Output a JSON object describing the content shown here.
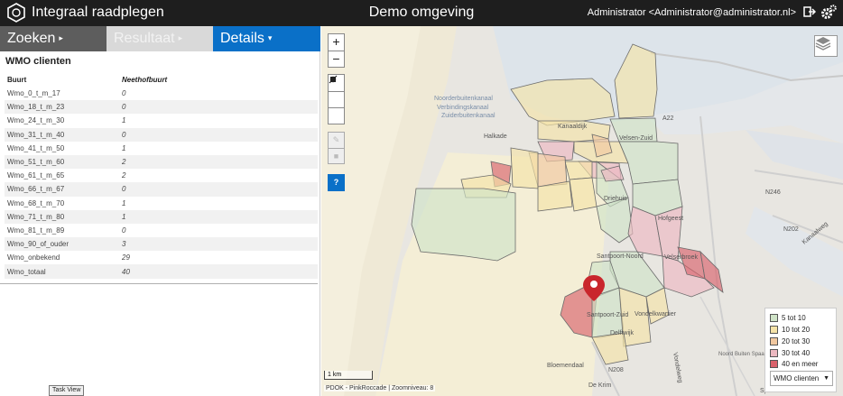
{
  "header": {
    "app_title": "Integraal raadplegen",
    "env_title": "Demo omgeving",
    "user": "Administrator <Administrator@administrator.nl>",
    "icons": [
      "app-logo-icon",
      "logout-icon",
      "settings-cogs-icon"
    ]
  },
  "tabs": [
    {
      "label": "Zoeken",
      "arrow": "▸"
    },
    {
      "label": "Resultaat",
      "arrow": "▸"
    },
    {
      "label": "Details",
      "arrow": "▾"
    }
  ],
  "panel": {
    "title": "WMO clienten",
    "columns": [
      "Buurt",
      "Neethofbuurt"
    ],
    "rows": [
      [
        "Wmo_0_t_m_17",
        "0"
      ],
      [
        "Wmo_18_t_m_23",
        "0"
      ],
      [
        "Wmo_24_t_m_30",
        "1"
      ],
      [
        "Wmo_31_t_m_40",
        "0"
      ],
      [
        "Wmo_41_t_m_50",
        "1"
      ],
      [
        "Wmo_51_t_m_60",
        "2"
      ],
      [
        "Wmo_61_t_m_65",
        "2"
      ],
      [
        "Wmo_66_t_m_67",
        "0"
      ],
      [
        "Wmo_68_t_m_70",
        "1"
      ],
      [
        "Wmo_71_t_m_80",
        "1"
      ],
      [
        "Wmo_81_t_m_89",
        "0"
      ],
      [
        "Wmo_90_of_ouder",
        "3"
      ],
      [
        "Wmo_onbekend",
        "29"
      ],
      [
        "Wmo_totaal",
        "40"
      ]
    ]
  },
  "map": {
    "zoom_in": "+",
    "zoom_out": "−",
    "help": "?",
    "scale": "1 km",
    "attribution": "PDOK - PinkRoccade | Zoomniveau: 8",
    "labels": {
      "noordzeekanaal": "Noorderbuitenkanaal",
      "verbinding": "Verbindingskanaal",
      "zuiderbuiten": "Zuiderbuitenkanaal",
      "kanaaldijk": "Kanaaldijk",
      "velsen_zuid": "Velsen-Zuid",
      "driehuis": "Driehuis",
      "hofgeest": "Hofgeest",
      "santpoort_noord": "Santpoort-Noord",
      "velserbroek": "Velserbroek",
      "santpoort_zuid": "Santpoort-Zuid",
      "vondelkwartier": "Vondelkwartier",
      "delftwijk": "Delftwijk",
      "bloemendaal": "Bloemendaal",
      "de_krim": "De Krim",
      "spaarnwoude": "Spaarnwoude",
      "n246": "N246",
      "n202": "N202",
      "n208": "N208",
      "a22": "A22",
      "kanaalweg": "Kanaalweg",
      "vondelweg": "Vondelweg",
      "buitenrust": "Noord Buiten Spaarne",
      "halkade": "Halkade"
    },
    "legend": {
      "items": [
        {
          "label": "5 tot 10",
          "color": "#cfe3c7"
        },
        {
          "label": "10 tot 20",
          "color": "#f5e3a8"
        },
        {
          "label": "20 tot 30",
          "color": "#f1c8a0"
        },
        {
          "label": "30 tot 40",
          "color": "#ecb9c1"
        },
        {
          "label": "40 en meer",
          "color": "#d9626c"
        }
      ],
      "selected": "WMO clienten"
    }
  },
  "taskbar": {
    "tooltip": "Task View"
  }
}
